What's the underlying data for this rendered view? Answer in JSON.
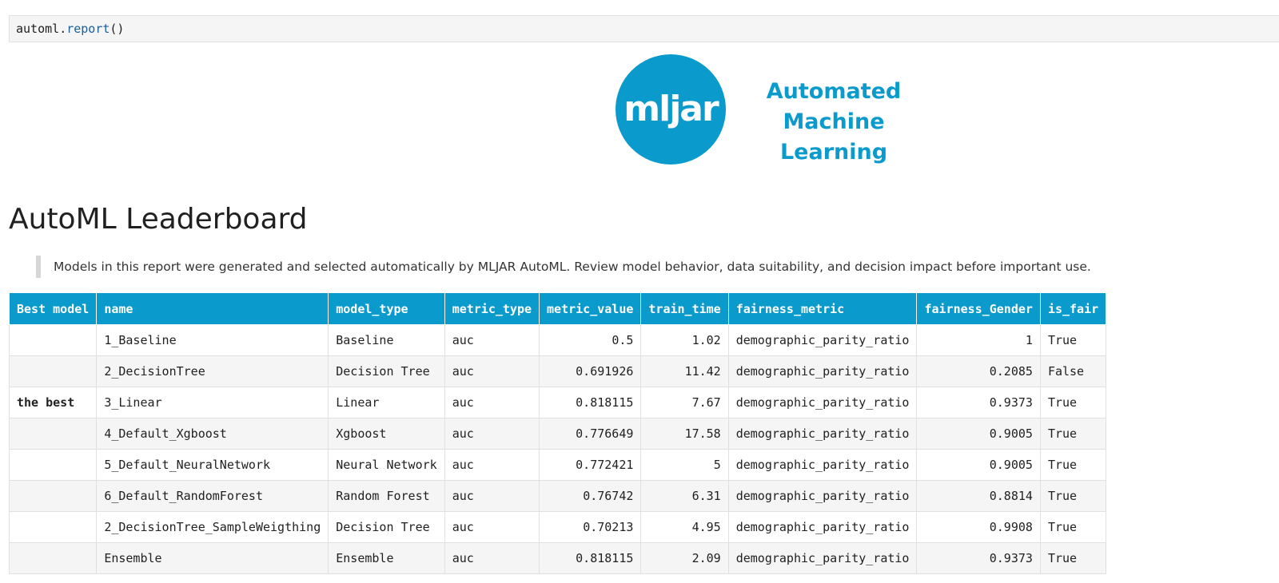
{
  "code_cell": {
    "object": "automl",
    "dot": ".",
    "method": "report",
    "parens": "()"
  },
  "logo": {
    "word": "mljar",
    "tagline_line1": "Automated",
    "tagline_line2": "Machine Learning",
    "color": "#0a9acc"
  },
  "page": {
    "title": "AutoML Leaderboard",
    "note": "Models in this report were generated and selected automatically by MLJAR AutoML. Review model behavior, data suitability, and decision impact before important use."
  },
  "leaderboard": {
    "header_color": "#0a9acc",
    "columns": [
      "Best model",
      "name",
      "model_type",
      "metric_type",
      "metric_value",
      "train_time",
      "fairness_metric",
      "fairness_Gender",
      "is_fair"
    ],
    "rows": [
      {
        "best": "",
        "name": "1_Baseline",
        "model_type": "Baseline",
        "metric_type": "auc",
        "metric_value": "0.5",
        "train_time": "1.02",
        "fairness_metric": "demographic_parity_ratio",
        "fairness_gender": "1",
        "is_fair": "True"
      },
      {
        "best": "",
        "name": "2_DecisionTree",
        "model_type": "Decision Tree",
        "metric_type": "auc",
        "metric_value": "0.691926",
        "train_time": "11.42",
        "fairness_metric": "demographic_parity_ratio",
        "fairness_gender": "0.2085",
        "is_fair": "False"
      },
      {
        "best": "the best",
        "name": "3_Linear",
        "model_type": "Linear",
        "metric_type": "auc",
        "metric_value": "0.818115",
        "train_time": "7.67",
        "fairness_metric": "demographic_parity_ratio",
        "fairness_gender": "0.9373",
        "is_fair": "True"
      },
      {
        "best": "",
        "name": "4_Default_Xgboost",
        "model_type": "Xgboost",
        "metric_type": "auc",
        "metric_value": "0.776649",
        "train_time": "17.58",
        "fairness_metric": "demographic_parity_ratio",
        "fairness_gender": "0.9005",
        "is_fair": "True"
      },
      {
        "best": "",
        "name": "5_Default_NeuralNetwork",
        "model_type": "Neural Network",
        "metric_type": "auc",
        "metric_value": "0.772421",
        "train_time": "5",
        "fairness_metric": "demographic_parity_ratio",
        "fairness_gender": "0.9005",
        "is_fair": "True"
      },
      {
        "best": "",
        "name": "6_Default_RandomForest",
        "model_type": "Random Forest",
        "metric_type": "auc",
        "metric_value": "0.76742",
        "train_time": "6.31",
        "fairness_metric": "demographic_parity_ratio",
        "fairness_gender": "0.8814",
        "is_fair": "True"
      },
      {
        "best": "",
        "name": "2_DecisionTree_SampleWeigthing",
        "model_type": "Decision Tree",
        "metric_type": "auc",
        "metric_value": "0.70213",
        "train_time": "4.95",
        "fairness_metric": "demographic_parity_ratio",
        "fairness_gender": "0.9908",
        "is_fair": "True"
      },
      {
        "best": "",
        "name": "Ensemble",
        "model_type": "Ensemble",
        "metric_type": "auc",
        "metric_value": "0.818115",
        "train_time": "2.09",
        "fairness_metric": "demographic_parity_ratio",
        "fairness_gender": "0.9373",
        "is_fair": "True"
      }
    ]
  }
}
